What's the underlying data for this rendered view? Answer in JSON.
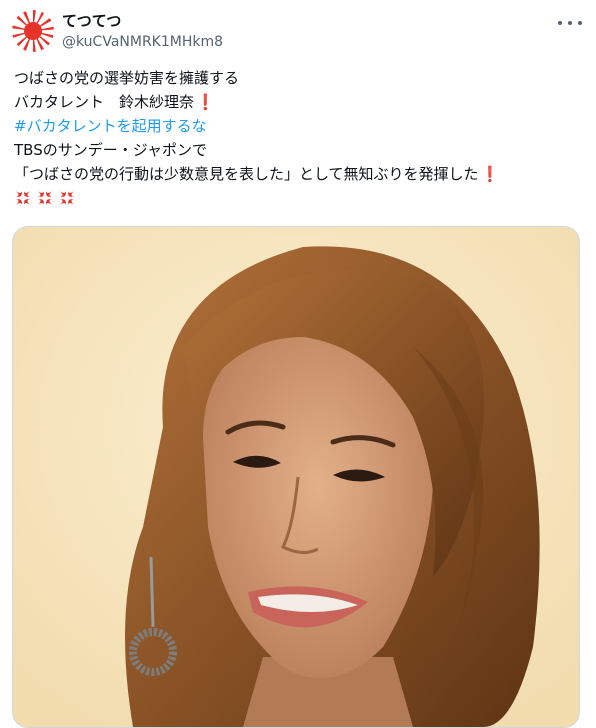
{
  "tweet": {
    "author": {
      "display_name": "てつてつ",
      "handle": "@kuCVaNMRK1MHkm8"
    },
    "lines": [
      "つばさの党の選挙妨害を擁護する",
      "バカタレント　鈴木紗理奈"
    ],
    "hashtag": "#バカタレントを起用するな",
    "lines_after": [
      "TBSのサンデー・ジャポンで",
      "「つばさの党の行動は少数意見を表した」として無知ぶりを発揮した"
    ],
    "exclamation_mark": "❗",
    "anger_icons": [
      "anger-icon",
      "anger-icon",
      "anger-icon"
    ]
  },
  "icons": {
    "avatar": "rising-sun-icon",
    "more": "more-options-icon"
  },
  "colors": {
    "hashtag": "#1d9bf0",
    "secondary_text": "#536471",
    "exclaim": "#e0245e",
    "media_border": "#cfd9de"
  }
}
